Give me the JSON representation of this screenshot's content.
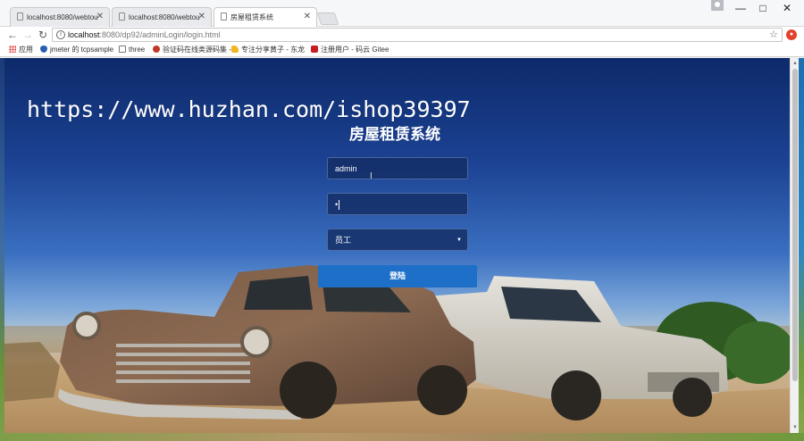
{
  "browser": {
    "tabs": [
      {
        "title": "localhost:8080/webtou",
        "active": false
      },
      {
        "title": "localhost:8080/webtou",
        "active": false
      },
      {
        "title": "房屋租赁系统",
        "active": true
      }
    ],
    "url_host": "localhost",
    "url_rest": ":8080/dp92/adminLogin/login.html",
    "bookmarks": [
      {
        "label": "应用",
        "icon": "apps-icon"
      },
      {
        "label": "jmeter 的 tcpsample",
        "icon": "shield-icon"
      },
      {
        "label": "three",
        "icon": "page-icon"
      },
      {
        "label": "验证码在线类源码集 -",
        "icon": "site-icon"
      },
      {
        "label": "专注分享黄子 - 东龙",
        "icon": "hand-icon"
      },
      {
        "label": "注册用户 - 码云 Gitee",
        "icon": "gitee-icon"
      }
    ],
    "window_controls": {
      "minimize": "—",
      "maximize": "□",
      "close": "✕"
    },
    "colors": {
      "accent_button": "#1d6fc7",
      "field_bg": "#142d64"
    }
  },
  "page": {
    "watermark": "https://www.huzhan.com/ishop39397",
    "title": "房屋租赁系统",
    "username_value": "admin",
    "password_value": "•",
    "role_selected": "员工",
    "login_label": "登陆"
  }
}
